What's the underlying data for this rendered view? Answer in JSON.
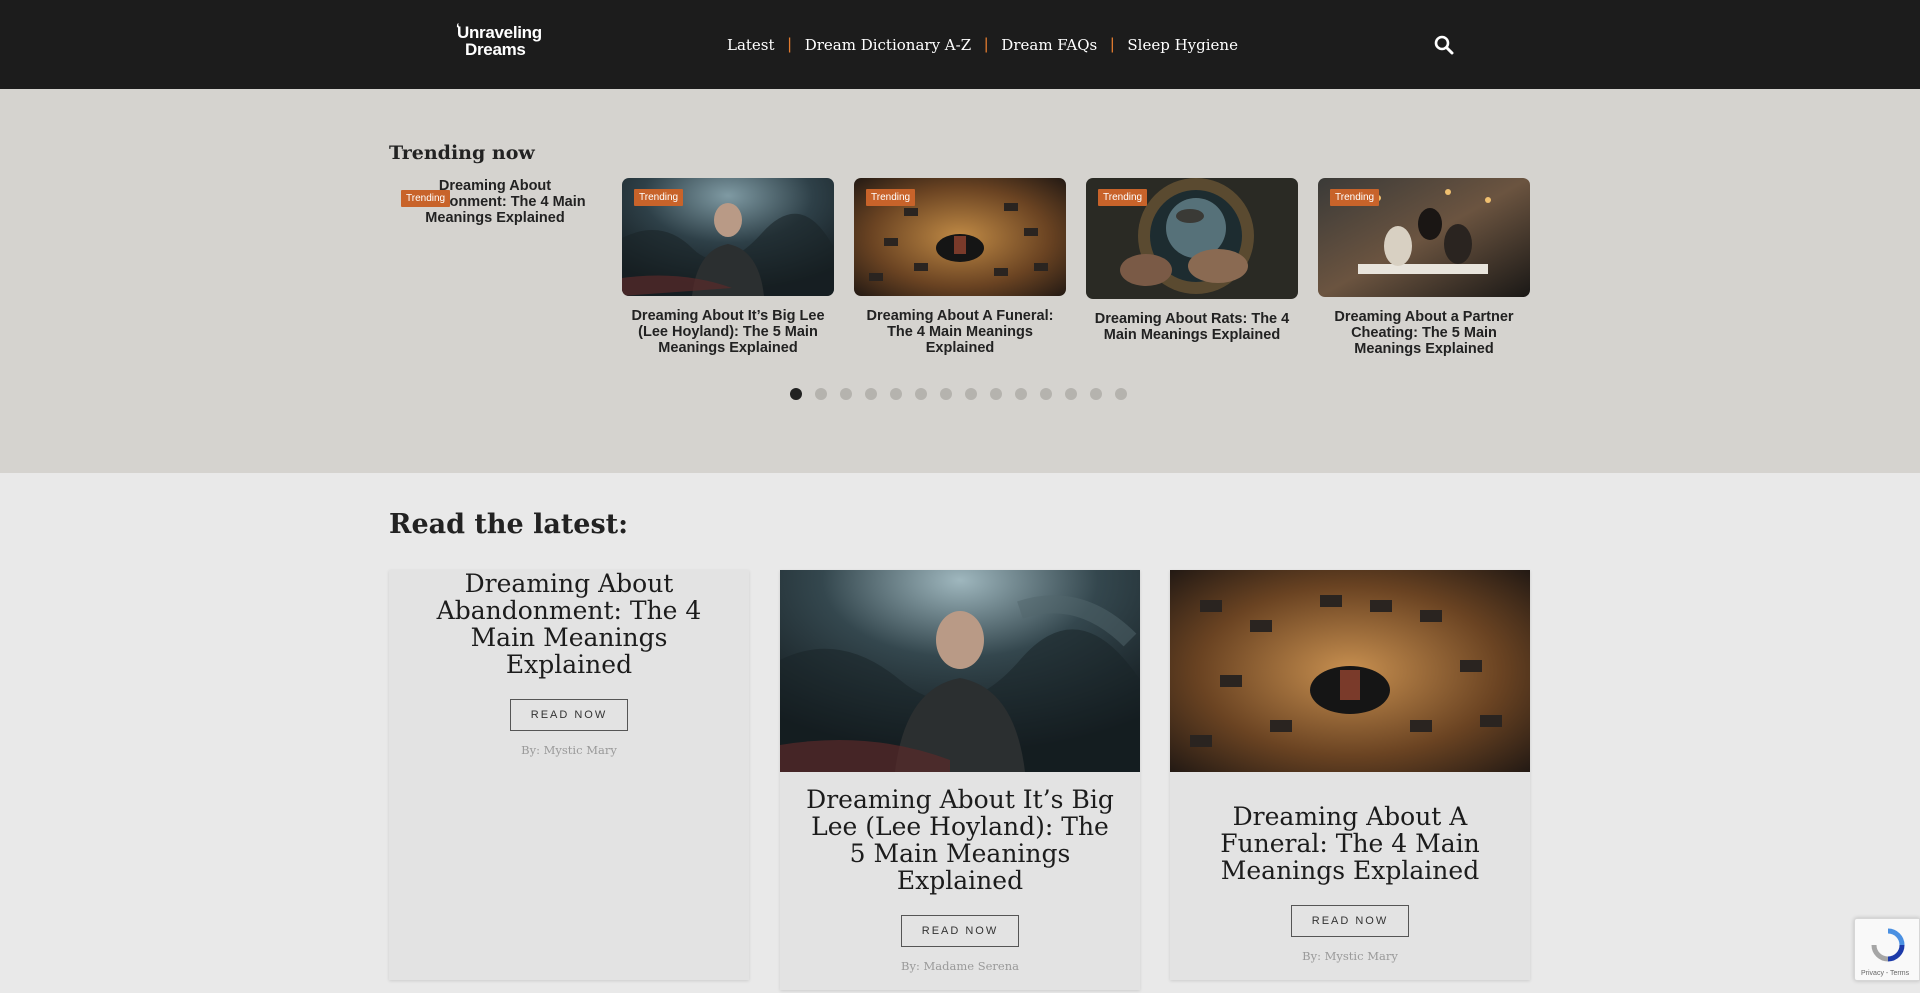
{
  "header": {
    "logo_line1": "Unraveling",
    "logo_line2": "Dreams",
    "nav": [
      "Latest",
      "Dream Dictionary A-Z",
      "Dream FAQs",
      "Sleep Hygiene"
    ],
    "separator": "|"
  },
  "trending": {
    "heading": "Trending now",
    "badge": "Trending",
    "cards": [
      {
        "title": "Dreaming About Abandonment: The 4 Main Meanings Explained",
        "image": "none"
      },
      {
        "title": "Dreaming About It’s Big Lee (Lee Hoyland): The 5 Main Meanings Explained",
        "image": "man-in-dark-dream"
      },
      {
        "title": "Dreaming About A Funeral: The 4 Main Meanings Explained",
        "image": "funeral-crowd-aerial"
      },
      {
        "title": "Dreaming About Rats: The 4 Main Meanings Explained",
        "image": "rats-in-tunnel"
      },
      {
        "title": "Dreaming About a Partner Cheating: The 5 Main Meanings Explained",
        "image": "couple-in-restaurant"
      }
    ],
    "dots_count": 14,
    "active_dot": 0
  },
  "latest": {
    "heading": "Read the latest:",
    "button_label": "READ NOW",
    "cards": [
      {
        "title": "Dreaming About Abandonment: The 4 Main Meanings Explained",
        "author": "By: Mystic Mary"
      },
      {
        "title": "Dreaming About It’s Big Lee (Lee Hoyland): The 5 Main Meanings Explained",
        "author": "By: Madame Serena"
      },
      {
        "title": "Dreaming About A Funeral: The 4 Main Meanings Explained",
        "author": "By: Mystic Mary"
      }
    ]
  },
  "recaptcha": {
    "text": "Privacy - Terms"
  },
  "colors": {
    "header_bg": "#1c1c1c",
    "accent": "#c8632a",
    "separator": "#e07a2e",
    "trending_bg": "#d5d3cf",
    "page_bg": "#e9e9e9"
  }
}
